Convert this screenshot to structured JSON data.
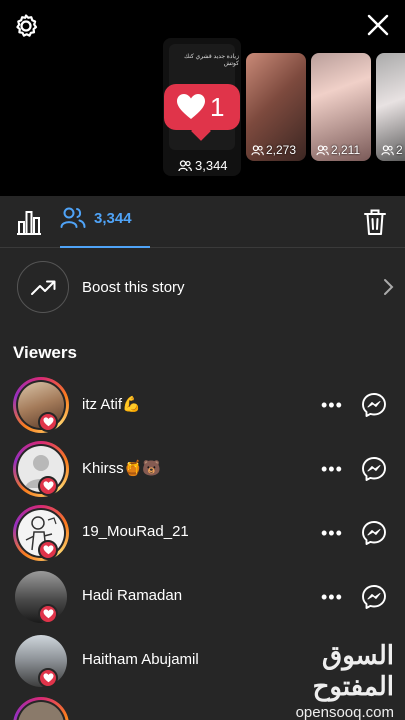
{
  "header": {
    "main_story": {
      "caption": "زيادة جديد قشري كنك كوتش",
      "likes": "1",
      "views": "3,344"
    },
    "other_stories": [
      {
        "views": "2,273"
      },
      {
        "views": "2,211"
      },
      {
        "views": "2"
      }
    ]
  },
  "tabs": {
    "viewers_count": "3,344"
  },
  "boost": {
    "label": "Boost this story"
  },
  "viewers": {
    "title": "Viewers",
    "list": [
      {
        "name": "itz Atif💪"
      },
      {
        "name": "Khirss🍯🐻"
      },
      {
        "name": "19_MouRad_21"
      },
      {
        "name": "Hadi Ramadan"
      },
      {
        "name": "Haitham Abujamil"
      }
    ],
    "more_symbol": "•••"
  },
  "watermark": {
    "arabic": "السوق المفتوح",
    "latin": "opensooq.com"
  },
  "colors": {
    "accent": "#4fa3f7",
    "like": "#e0344a",
    "panel": "#262626"
  }
}
